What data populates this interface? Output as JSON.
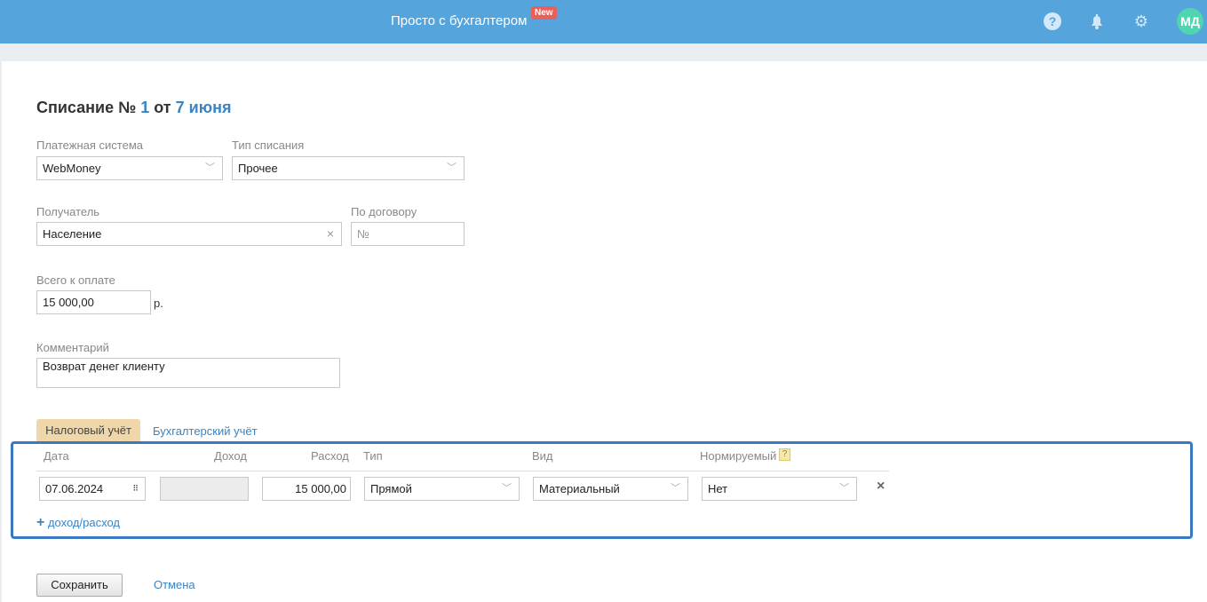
{
  "header": {
    "brand": "Просто с бухгалтером",
    "badge": "New",
    "avatar": "МД"
  },
  "title": {
    "prefix": "Списание №",
    "number": "1",
    "mid": "от",
    "date": "7 июня"
  },
  "form": {
    "payment_system": {
      "label": "Платежная система",
      "value": "WebMoney"
    },
    "writeoff_type": {
      "label": "Тип списания",
      "value": "Прочее"
    },
    "recipient": {
      "label": "Получатель",
      "value": "Население"
    },
    "contract": {
      "label": "По договору",
      "placeholder": "№"
    },
    "total": {
      "label": "Всего к оплате",
      "value": "15 000,00",
      "unit": "р."
    },
    "comment": {
      "label": "Комментарий",
      "value": "Возврат денег клиенту"
    }
  },
  "tabs": [
    "Налоговый учёт",
    "Бухгалтерский учёт"
  ],
  "table": {
    "headers": {
      "date": "Дата",
      "income": "Доход",
      "expense": "Расход",
      "type": "Тип",
      "kind": "Вид",
      "normalized": "Нормируемый",
      "help": "?"
    },
    "row": {
      "date": "07.06.2024",
      "income": "",
      "expense": "15 000,00",
      "type": "Прямой",
      "kind": "Материальный",
      "normalized": "Нет"
    },
    "add_link": "доход/расход"
  },
  "actions": {
    "save": "Сохранить",
    "cancel": "Отмена"
  }
}
